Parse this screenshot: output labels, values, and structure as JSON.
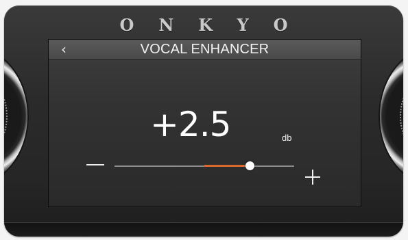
{
  "brand": {
    "name": "ONKYO"
  },
  "screen": {
    "title": "VOCAL ENHANCER",
    "back_icon": "‹"
  },
  "control": {
    "value_text": "+2.5",
    "unit": "db",
    "value": 2.5,
    "min": -5,
    "max": 5
  },
  "colors": {
    "accent": "#d9692a",
    "text": "#ffffff",
    "screen_bg": "#333333",
    "device_bg": "#2b2b2b"
  },
  "icons": {
    "back": "chevron-left-icon",
    "decrease": "minus-icon",
    "increase": "plus-icon"
  }
}
